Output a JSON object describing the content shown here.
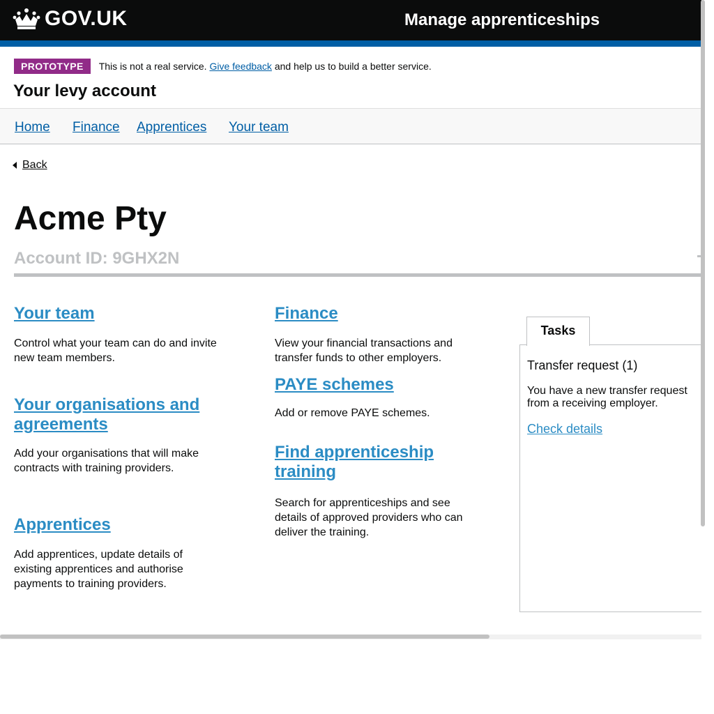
{
  "header": {
    "logo_text": "GOV.UK",
    "logo_icon": "crown-icon",
    "service_name": "Manage apprenticeships"
  },
  "phase_banner": {
    "tag": "PROTOTYPE",
    "text_before": "This is not a real service. ",
    "link": "Give feedback",
    "text_after": " and help us to build a better service."
  },
  "account_title": "Your levy account",
  "nav": {
    "items": [
      {
        "label": "Home"
      },
      {
        "label": "Finance"
      },
      {
        "label": "Apprentices"
      },
      {
        "label": "Your team"
      }
    ]
  },
  "back_label": "Back",
  "organisation": {
    "name": "Acme Pty",
    "account_id": "Account ID: 9GHX2N"
  },
  "cards": {
    "your_team": {
      "title": "Your team",
      "desc": "Control what your team can do and invite new team members."
    },
    "organisations": {
      "title": "Your organisations and agreements",
      "desc": "Add your organisations that will make contracts with training providers."
    },
    "apprentices": {
      "title": "Apprentices",
      "desc": "Add apprentices, update details of existing apprentices and authorise payments to training providers."
    },
    "finance": {
      "title": "Finance",
      "desc": "View your financial transactions and transfer funds to other employers."
    },
    "paye": {
      "title": "PAYE schemes",
      "desc": "Add or remove PAYE schemes."
    },
    "find_training": {
      "title": "Find apprenticeship training",
      "desc": "Search for apprenticeships and see details of approved providers who can deliver the training."
    }
  },
  "tasks": {
    "tab_label": "Tasks",
    "title": "Transfer request (1)",
    "desc": "You have a new transfer request from a receiving employer.",
    "link": "Check details"
  },
  "colors": {
    "header_bg": "#0b0c0c",
    "header_accent": "#005ea5",
    "phase_tag": "#912b88",
    "link": "#2b8cc4",
    "nav_link": "#005ea5",
    "muted": "#bfc1c3"
  }
}
